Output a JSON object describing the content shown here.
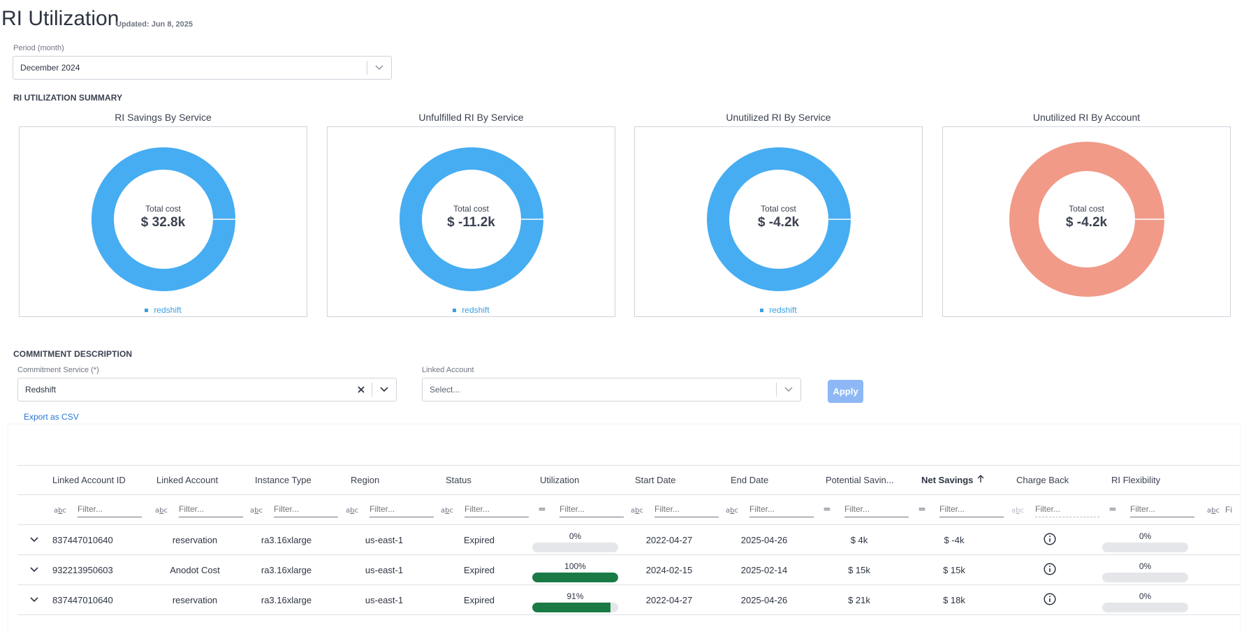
{
  "header": {
    "title": "RI Utilization",
    "updated": "Updated: Jun 8, 2025"
  },
  "period": {
    "label": "Period (month)",
    "value": "December 2024"
  },
  "summary": {
    "title": "RI UTILIZATION SUMMARY",
    "charts": [
      {
        "title": "RI Savings By Service",
        "center_label": "Total cost",
        "center_value": "$ 32.8k",
        "legend": "redshift",
        "color": "#46adf2"
      },
      {
        "title": "Unfulfilled RI By Service",
        "center_label": "Total cost",
        "center_value": "$ -11.2k",
        "legend": "redshift",
        "color": "#46adf2"
      },
      {
        "title": "Unutilized RI By Service",
        "center_label": "Total cost",
        "center_value": "$ -4.2k",
        "legend": "redshift",
        "color": "#46adf2"
      },
      {
        "title": "Unutilized RI By Account",
        "center_label": "Total cost",
        "center_value": "$ -4.2k",
        "legend": "",
        "color": "#f19a88"
      }
    ]
  },
  "commitment": {
    "title": "COMMITMENT DESCRIPTION",
    "service_label": "Commitment Service (*)",
    "service_value": "Redshift",
    "account_label": "Linked Account",
    "account_placeholder": "Select...",
    "apply": "Apply",
    "export": "Export as CSV"
  },
  "table": {
    "columns": [
      "Linked Account ID",
      "Linked Account",
      "Instance Type",
      "Region",
      "Status",
      "Utilization",
      "Start Date",
      "End Date",
      "Potential Savin...",
      "Net Savings",
      "Charge Back",
      "RI Flexibility"
    ],
    "filter_placeholder": "Filter...",
    "filter_partial": "Fi",
    "rows": [
      {
        "account_id": "837447010640",
        "account": "reservation",
        "instance": "ra3.16xlarge",
        "region": "us-east-1",
        "status": "Expired",
        "utilization": "0%",
        "utilization_value": 0,
        "start": "2022-04-27",
        "end": "2025-04-26",
        "potential": "$ 4k",
        "net": "$ -4k",
        "flex": "0%",
        "flex_value": 0
      },
      {
        "account_id": "932213950603",
        "account": "Anodot Cost",
        "instance": "ra3.16xlarge",
        "region": "us-east-1",
        "status": "Expired",
        "utilization": "100%",
        "utilization_value": 100,
        "start": "2024-02-15",
        "end": "2025-02-14",
        "potential": "$ 15k",
        "net": "$ 15k",
        "flex": "0%",
        "flex_value": 0
      },
      {
        "account_id": "837447010640",
        "account": "reservation",
        "instance": "ra3.16xlarge",
        "region": "us-east-1",
        "status": "Expired",
        "utilization": "91%",
        "utilization_value": 91,
        "start": "2022-04-27",
        "end": "2025-04-26",
        "potential": "$ 21k",
        "net": "$ 18k",
        "flex": "0%",
        "flex_value": 0
      }
    ]
  }
}
